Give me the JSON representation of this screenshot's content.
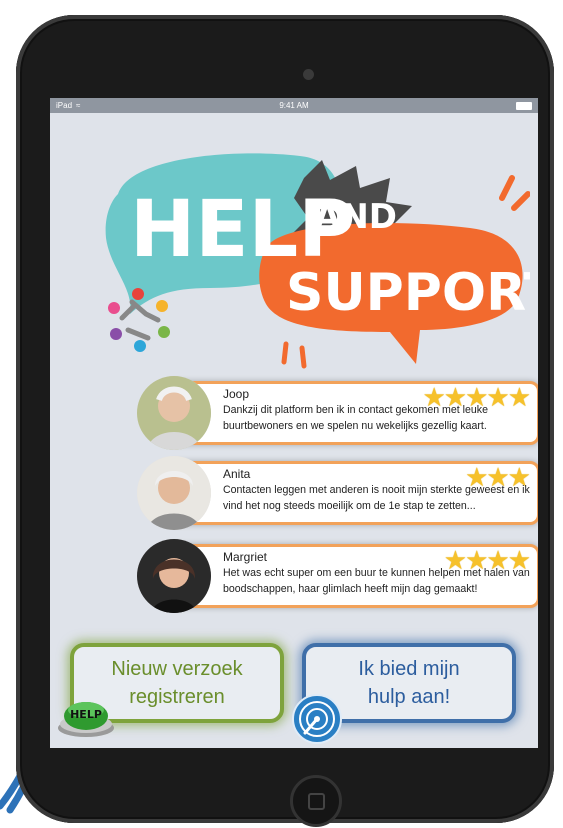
{
  "status_bar": {
    "device": "iPad",
    "time": "9:41 AM"
  },
  "logo": {
    "word1": "HELP",
    "word2": "AND",
    "word3": "SUPPORT"
  },
  "reviews": [
    {
      "name": "Joop",
      "rating": 5,
      "text": "Dankzij dit platform ben ik in contact gekomen met leuke buurtbewoners en we spelen nu wekelijks gezellig kaart."
    },
    {
      "name": "Anita",
      "rating": 3,
      "text": "Contacten leggen met anderen is nooit mijn sterkte geweest en ik vind het nog steeds moeilijk om de 1e stap te zetten..."
    },
    {
      "name": "Margriet",
      "rating": 4,
      "text": "Het was echt super om een buur te kunnen helpen met halen van boodschappen, haar glimlach heeft mijn dag gemaakt!"
    }
  ],
  "buttons": {
    "new_request": {
      "line1": "Nieuw verzoek",
      "line2": "registreren"
    },
    "offer_help": {
      "line1": "Ik bied mijn",
      "line2": "hulp aan!"
    }
  },
  "help_badge": "HELP",
  "colors": {
    "accent_orange": "#f26a2e",
    "teal": "#6cc8c9",
    "green": "#7ea33c",
    "blue": "#3f6fa9",
    "star": "#f6c12b"
  }
}
